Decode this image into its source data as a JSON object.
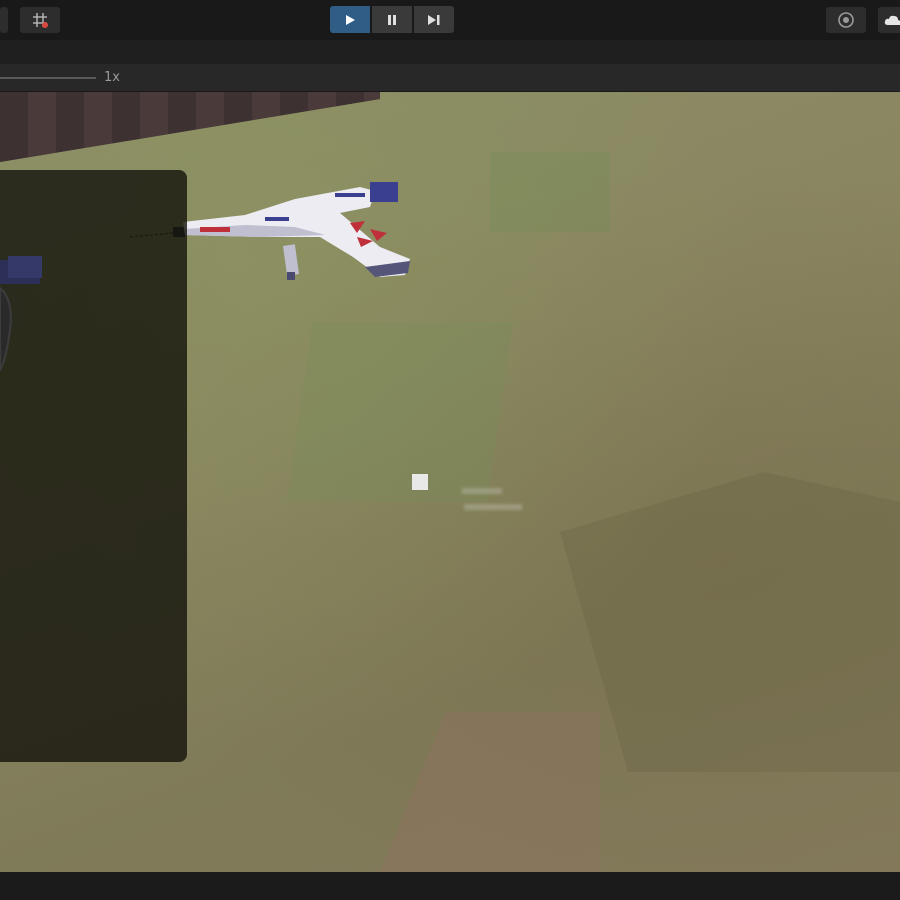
{
  "toolbar": {
    "left_button_icon": "grid-icon",
    "play_controls": [
      {
        "icon": "play-icon",
        "active": true
      },
      {
        "icon": "pause-icon",
        "active": false
      },
      {
        "icon": "step-icon",
        "active": false
      }
    ],
    "right_icons": [
      "collab-icon",
      "cloud-icon"
    ]
  },
  "speed": {
    "label": "1x"
  },
  "colors": {
    "toolbar_bg": "#191919",
    "play_active": "#2f5d86",
    "ground": "#8a8561",
    "overlay_panel": "#16160e",
    "accent_red": "#c0303a",
    "weapon_blue": "#3b3f8f"
  }
}
